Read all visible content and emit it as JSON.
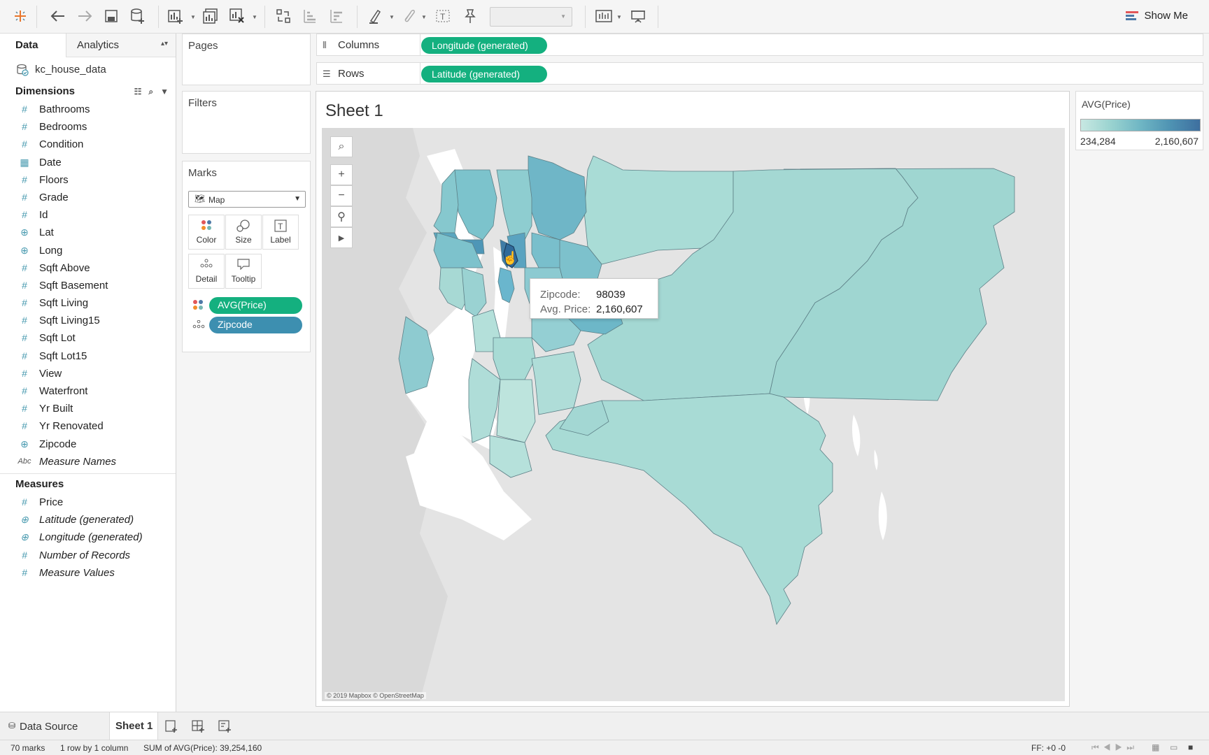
{
  "toolbar": {
    "show_me_label": "Show Me",
    "colors": {
      "accent": "#14b07f",
      "icon": "#555555"
    }
  },
  "left_panel": {
    "tab_data": "Data",
    "tab_analytics": "Analytics",
    "datasource_name": "kc_house_data",
    "dimensions_header": "Dimensions",
    "measures_header": "Measures",
    "dimensions": [
      {
        "label": "Bathrooms",
        "icon": "hash-icon"
      },
      {
        "label": "Bedrooms",
        "icon": "hash-icon"
      },
      {
        "label": "Condition",
        "icon": "hash-icon"
      },
      {
        "label": "Date",
        "icon": "calendar-icon"
      },
      {
        "label": "Floors",
        "icon": "hash-icon"
      },
      {
        "label": "Grade",
        "icon": "hash-icon"
      },
      {
        "label": "Id",
        "icon": "hash-icon"
      },
      {
        "label": "Lat",
        "icon": "globe-icon"
      },
      {
        "label": "Long",
        "icon": "globe-icon"
      },
      {
        "label": "Sqft Above",
        "icon": "hash-icon"
      },
      {
        "label": "Sqft Basement",
        "icon": "hash-icon"
      },
      {
        "label": "Sqft Living",
        "icon": "hash-icon"
      },
      {
        "label": "Sqft Living15",
        "icon": "hash-icon"
      },
      {
        "label": "Sqft Lot",
        "icon": "hash-icon"
      },
      {
        "label": "Sqft Lot15",
        "icon": "hash-icon"
      },
      {
        "label": "View",
        "icon": "hash-icon"
      },
      {
        "label": "Waterfront",
        "icon": "hash-icon"
      },
      {
        "label": "Yr Built",
        "icon": "hash-icon"
      },
      {
        "label": "Yr Renovated",
        "icon": "hash-icon"
      },
      {
        "label": "Zipcode",
        "icon": "globe-icon"
      },
      {
        "label": "Measure Names",
        "icon": "abc-icon"
      }
    ],
    "measures": [
      {
        "label": "Price",
        "icon": "hash-icon"
      },
      {
        "label": "Latitude (generated)",
        "icon": "globe-icon"
      },
      {
        "label": "Longitude (generated)",
        "icon": "globe-icon"
      },
      {
        "label": "Number of Records",
        "icon": "hash-icon"
      },
      {
        "label": "Measure Values",
        "icon": "hash-icon"
      }
    ],
    "abc_glyph": "Abc"
  },
  "cards": {
    "pages": "Pages",
    "filters": "Filters",
    "marks": "Marks",
    "mark_type": "Map",
    "buttons": {
      "color": "Color",
      "size": "Size",
      "label": "Label",
      "detail": "Detail",
      "tooltip": "Tooltip"
    },
    "pill_avg_price": "AVG(Price)",
    "pill_zipcode": "Zipcode"
  },
  "shelves": {
    "columns_label": "Columns",
    "rows_label": "Rows",
    "columns_pill": "Longitude (generated)",
    "rows_pill": "Latitude (generated)"
  },
  "sheet": {
    "title": "Sheet 1",
    "attribution": "© 2019 Mapbox © OpenStreetMap"
  },
  "legend": {
    "title": "AVG(Price)",
    "min": "234,284",
    "max": "2,160,607"
  },
  "tooltip": {
    "zip_key": "Zipcode:",
    "zip_value": "98039",
    "price_key": "Avg. Price:",
    "price_value": "2,160,607"
  },
  "tabs": {
    "data_source": "Data Source",
    "sheet1": "Sheet 1"
  },
  "status": {
    "marks": "70 marks",
    "rows_cols": "1 row by 1 column",
    "sum": "SUM of AVG(Price): 39,254,160",
    "ff": "FF: +0 -0"
  }
}
